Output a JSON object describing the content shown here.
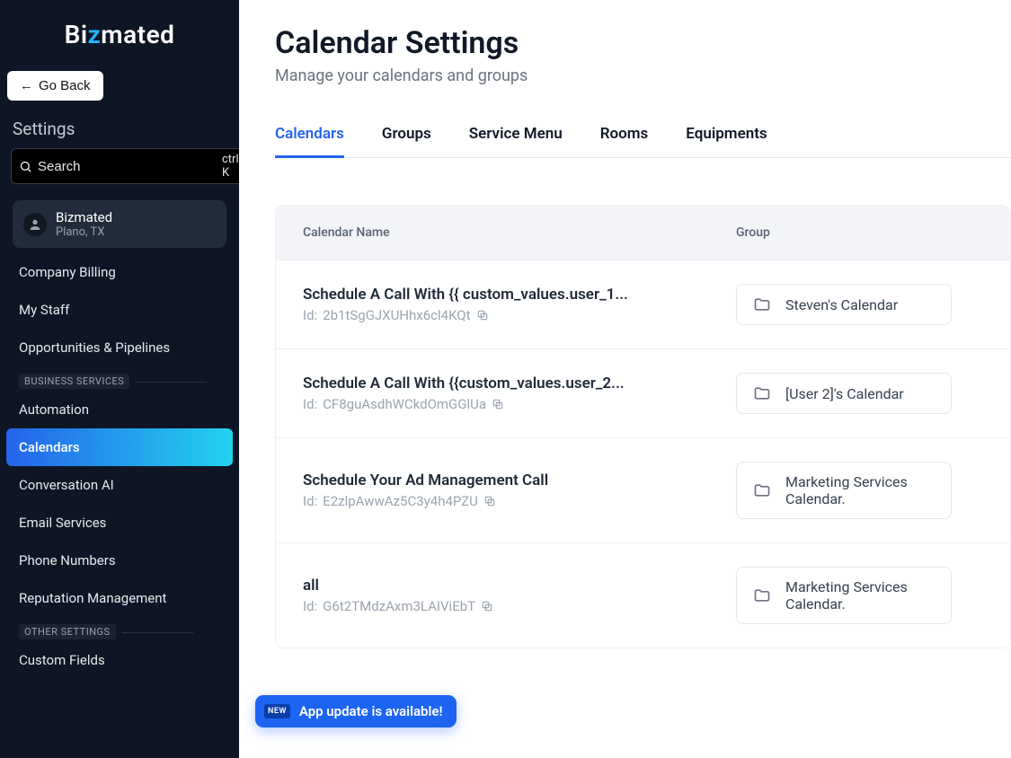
{
  "brand": {
    "pre": "Bi",
    "accent": "z",
    "post": "mated"
  },
  "go_back": "Go Back",
  "settings_label": "Settings",
  "search": {
    "placeholder": "Search",
    "shortcut": "ctrl K"
  },
  "org": {
    "name": "Bizmated",
    "location": "Plano, TX"
  },
  "nav": {
    "group0": [
      {
        "label": "Company Billing"
      },
      {
        "label": "My Staff"
      },
      {
        "label": "Opportunities & Pipelines"
      }
    ],
    "section1": "BUSINESS SERVICES",
    "group1": [
      {
        "label": "Automation"
      },
      {
        "label": "Calendars",
        "active": true
      },
      {
        "label": "Conversation AI"
      },
      {
        "label": "Email Services"
      },
      {
        "label": "Phone Numbers"
      },
      {
        "label": "Reputation Management"
      }
    ],
    "section2": "OTHER SETTINGS",
    "group2": [
      {
        "label": "Custom Fields"
      }
    ]
  },
  "page": {
    "title": "Calendar Settings",
    "subtitle": "Manage your calendars and groups"
  },
  "tabs": [
    "Calendars",
    "Groups",
    "Service Menu",
    "Rooms",
    "Equipments"
  ],
  "active_tab": 0,
  "table": {
    "headers": {
      "name": "Calendar Name",
      "group": "Group"
    },
    "rows": [
      {
        "name": "Schedule A Call With {{ custom_values.user_1...",
        "id_prefix": "Id:",
        "id": "2b1tSgGJXUHhx6cl4KQt",
        "group": "Steven's Calendar"
      },
      {
        "name": "Schedule A Call With {{custom_values.user_2...",
        "id_prefix": "Id:",
        "id": "CF8guAsdhWCkdOmGGlUa",
        "group": "[User 2]'s Calendar"
      },
      {
        "name": "Schedule Your Ad Management Call",
        "id_prefix": "Id:",
        "id": "E2zlpAwwAz5C3y4h4PZU",
        "group": "Marketing Services Calendar."
      },
      {
        "name": "all",
        "id_prefix": "Id:",
        "id": "G6t2TMdzAxm3LAIViEbT",
        "group": "Marketing Services Calendar."
      }
    ]
  },
  "toast": {
    "badge": "NEW",
    "text": "App update is available!"
  }
}
